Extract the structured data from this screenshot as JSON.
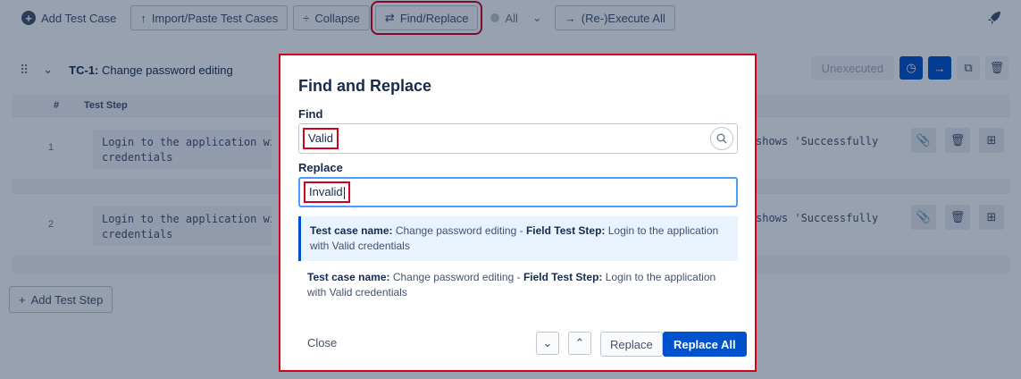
{
  "toolbar": {
    "add_test_case": "Add Test Case",
    "import_paste": "Import/Paste Test Cases",
    "collapse": "Collapse",
    "find_replace": "Find/Replace",
    "filter_all": "All",
    "reexecute_all": "(Re-)Execute All"
  },
  "test_case": {
    "id": "TC-1:",
    "title": "Change password editing",
    "status": "Unexecuted"
  },
  "steps_table": {
    "headers": [
      "#",
      "Test Step"
    ],
    "rows": [
      {
        "index": "1",
        "text": "Login to the application with\ncredentials",
        "expected_fragment": "shows 'Successfully"
      },
      {
        "index": "2",
        "text": "Login to the application with\ncredentials",
        "expected_fragment": "shows 'Successfully"
      }
    ],
    "add_step": "Add Test Step"
  },
  "modal": {
    "title": "Find and Replace",
    "find_label": "Find",
    "find_value": "Valid",
    "replace_label": "Replace",
    "replace_value": "Invalid",
    "results": [
      {
        "case_label": "Test case name:",
        "case_name": "Change password editing -",
        "field_label": "Field Test Step:",
        "field_text": "Login to the application with Valid credentials"
      },
      {
        "case_label": "Test case name:",
        "case_name": "Change password editing -",
        "field_label": "Field Test Step:",
        "field_text": "Login to the application with Valid credentials"
      }
    ],
    "close": "Close",
    "replace": "Replace",
    "replace_all": "Replace All"
  },
  "colors": {
    "primary": "#0052cc",
    "highlight_outline": "#d0021b",
    "overlay": "rgba(9,30,66,0.42)"
  },
  "icons": {
    "add": "plus-circle-icon",
    "import": "arrow-up-icon",
    "collapse": "collapse-icon",
    "find_replace": "swap-arrows-icon",
    "execute": "arrow-right-icon",
    "rocket": "rocket-icon",
    "search": "search-icon",
    "attachment": "paperclip-icon",
    "delete": "trash-icon",
    "duplicate": "copy-icon"
  }
}
